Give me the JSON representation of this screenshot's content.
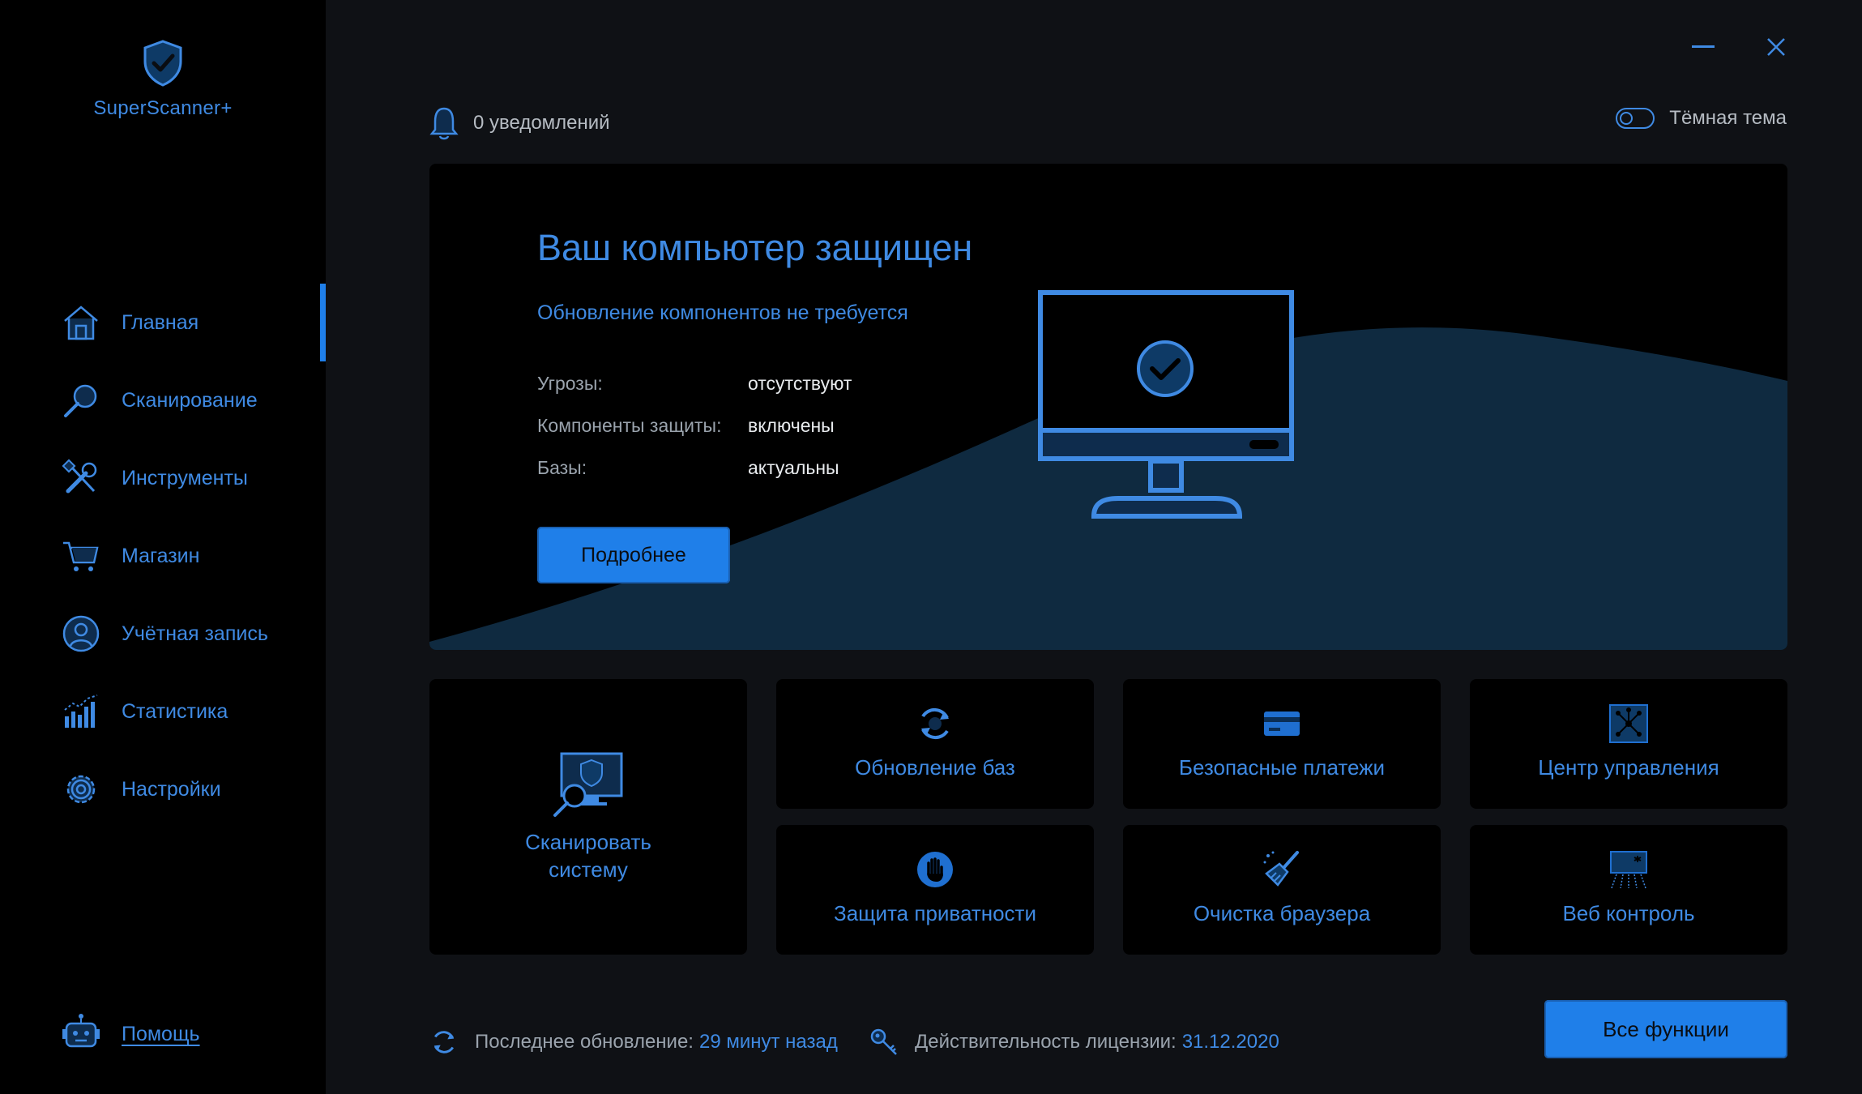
{
  "app": {
    "name": "SuperScanner+"
  },
  "sidebar": {
    "items": [
      {
        "label": "Главная",
        "icon": "home-icon",
        "active": true
      },
      {
        "label": "Сканирование",
        "icon": "magnifier-icon"
      },
      {
        "label": "Инструменты",
        "icon": "tools-icon"
      },
      {
        "label": "Магазин",
        "icon": "cart-icon"
      },
      {
        "label": "Учётная запись",
        "icon": "user-icon"
      },
      {
        "label": "Статистика",
        "icon": "chart-icon"
      },
      {
        "label": "Настройки",
        "icon": "gear-icon"
      }
    ],
    "help": {
      "label": "Помощь",
      "icon": "robot-icon"
    }
  },
  "header": {
    "notifications": "0 уведомлений",
    "theme_label": "Тёмная тема",
    "theme_enabled": false
  },
  "hero": {
    "title": "Ваш компьютер защищен",
    "subtitle": "Обновление компонентов не требуется",
    "rows": [
      {
        "key": "Угрозы:",
        "value": "отсутствуют"
      },
      {
        "key": "Компоненты защиты:",
        "value": "включены"
      },
      {
        "key": "Базы:",
        "value": "актуальны"
      }
    ],
    "button": "Подробнее"
  },
  "tiles": {
    "scan": {
      "line1": "Сканировать",
      "line2": "систему"
    },
    "update": "Обновление баз",
    "payments": "Безопасные платежи",
    "control": "Центр управления",
    "privacy": "Защита приватности",
    "browser": "Очистка браузера",
    "web": "Веб контроль"
  },
  "footer": {
    "last_update_label": "Последнее обновление:",
    "last_update_value": "29 минут назад",
    "license_label": "Действительность лицензии:",
    "license_value": "31.12.2020",
    "all_button": "Все функции"
  },
  "colors": {
    "accent": "#1f7fe9",
    "text_accent": "#3f8ae3",
    "bg": "#0f1115",
    "panel": "#000000"
  }
}
